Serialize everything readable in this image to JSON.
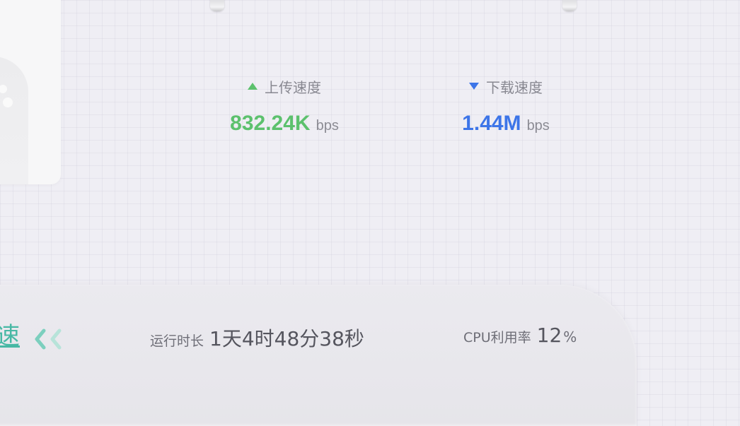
{
  "upload": {
    "icon": "triangle-up-icon",
    "label": "上传速度",
    "value": "832.24K",
    "unit": "bps",
    "color": "#5cc16d"
  },
  "download": {
    "icon": "triangle-down-icon",
    "label": "下载速度",
    "value": "1.44M",
    "unit": "bps",
    "color": "#3d75e8"
  },
  "bottom": {
    "accel_char": "速",
    "collapse_icon": "double-chevron-left-icon",
    "accent_color": "#48b8a5",
    "uptime_label": "运行时长",
    "uptime_value": "1天4时48分38秒",
    "cpu_label": "CPU利用率",
    "cpu_value": "12",
    "cpu_unit": "%"
  }
}
